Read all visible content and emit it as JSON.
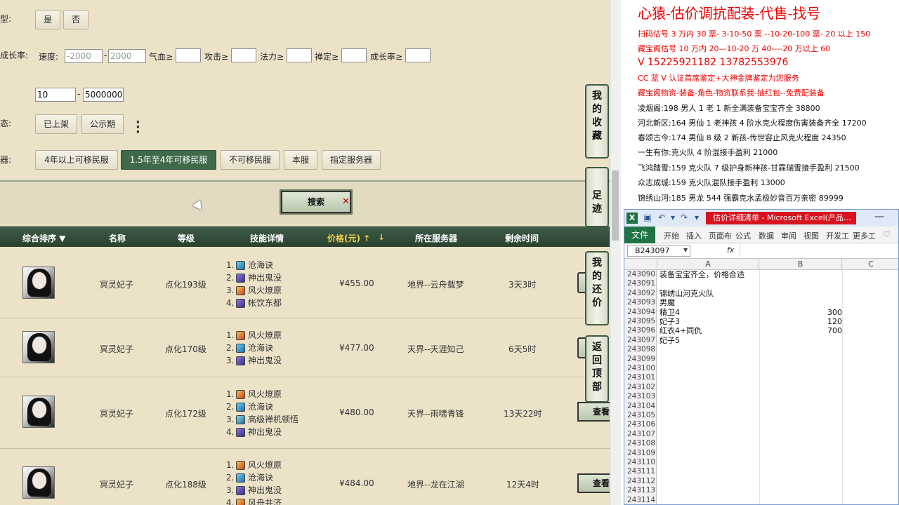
{
  "filters": {
    "type_label": "类型:",
    "yes_label": "是",
    "no_label": "否",
    "attr_label": "加成长率:",
    "speed_label": "速度:",
    "speed_min_placeholder": "-2000",
    "speed_max_placeholder": "2000",
    "hp_label": "气血≥",
    "atk_label": "攻击≥",
    "magic_label": "法力≥",
    "zen_label": "禅定≥",
    "growth_label": "成长率≥",
    "range_min": "10",
    "range_max": "5000000",
    "status_label": "状态:",
    "on_shelf_label": "已上架",
    "public_label": "公示期",
    "server_label": "服务器:",
    "migrate_options": [
      "4年以上可移民服",
      "1.5年至4年可移民服",
      "不可移民服",
      "本服",
      "指定服务器"
    ],
    "dash": "-"
  },
  "search_label": "搜索",
  "table": {
    "headers": [
      "综合排序 ▼",
      "名称",
      "等级",
      "技能详情",
      "价格(元) ↑",
      "所在服务器",
      "剩余时间"
    ],
    "price_arrow": "↓",
    "rows": [
      {
        "name": "冥灵妃子",
        "level": "点化193级",
        "price": "¥455.00",
        "server": "地界--云舟载梦",
        "time": "3天3时",
        "skills": [
          {
            "n": "1.",
            "t": "沧海诀",
            "i": "water"
          },
          {
            "n": "2.",
            "t": "神出鬼没",
            "i": "ghost"
          },
          {
            "n": "3.",
            "t": "风火燎原",
            "i": "fire"
          },
          {
            "n": "4.",
            "t": "帐饮东都",
            "i": "ghost"
          }
        ]
      },
      {
        "name": "冥灵妃子",
        "level": "点化170级",
        "price": "¥477.00",
        "server": "天界--天涯知己",
        "time": "6天5时",
        "skills": [
          {
            "n": "1.",
            "t": "风火燎原",
            "i": "fire"
          },
          {
            "n": "2.",
            "t": "沧海诀",
            "i": "water"
          },
          {
            "n": "3.",
            "t": "神出鬼没",
            "i": "ghost"
          }
        ]
      },
      {
        "name": "冥灵妃子",
        "level": "点化172级",
        "price": "¥480.00",
        "server": "天界--雨啸青锋",
        "time": "13天22时",
        "skills": [
          {
            "n": "1.",
            "t": "风火燎原",
            "i": "fire"
          },
          {
            "n": "2.",
            "t": "沧海诀",
            "i": "water"
          },
          {
            "n": "3.",
            "t": "高级禅机顿悟",
            "i": "zen"
          },
          {
            "n": "4.",
            "t": "神出鬼没",
            "i": "ghost"
          }
        ]
      },
      {
        "name": "冥灵妃子",
        "level": "点化188级",
        "price": "¥484.00",
        "server": "地界--龙在江湖",
        "time": "12天4时",
        "skills": [
          {
            "n": "1.",
            "t": "风火燎原",
            "i": "fire"
          },
          {
            "n": "2.",
            "t": "沧海诀",
            "i": "water"
          },
          {
            "n": "3.",
            "t": "神出鬼没",
            "i": "ghost"
          },
          {
            "n": "4.",
            "t": "风舟共济",
            "i": "fire"
          }
        ]
      }
    ],
    "view_label": "查看"
  },
  "side_tabs": [
    "我的收藏",
    "足迹",
    "我的还价",
    "返回顶部"
  ],
  "ad": {
    "title": "心猿-估价调抗配装-代售-找号",
    "red_lines": [
      "扫码估号 3 万内 30 票- 3-10-50 票 --10-20-100 票- 20 以上 150",
      "藏宝阁估号 10 万内 20—10-20 万 40----20 万以上 60",
      "V 15225921182   13782553976",
      "CC 蓝 V 认证首席鉴定+大神金牌鉴定为您服务",
      "藏宝阁物资-装备-角色-物资联系我-抽红包--免费配装备"
    ],
    "black_lines": [
      {
        "k": "凌烟阁:",
        "v": "198 男人 1 老 1 新全满装备宝宝齐全 38800"
      },
      {
        "k": "河北新区:",
        "v": "164 男仙 1 老神孩 4 阶水克火程度伤害装备齐全 17200"
      },
      {
        "k": "春颂古今:",
        "v": "174 男仙 8 级 2 新孩-传世容止风克火程度 24350"
      },
      {
        "k": "一生有你:",
        "v": "克火队 4 阶混接手盈利 21000"
      },
      {
        "k": "飞鸿踏雪:",
        "v": "159 克火队 7 级护身新神孩-甘霖瑞雪接手盈利 21500"
      },
      {
        "k": "众志成城:",
        "v": "159 克火队混队接手盈利 13000"
      },
      {
        "k": "锦绣山河:",
        "v": "185 男龙 544 强霸克水孟极妙音百万亲密 89999"
      }
    ]
  },
  "excel": {
    "title": "估价详细清单 - Microsoft Excel(产品...",
    "tabs": [
      "文件",
      "开始",
      "插入",
      "页面布",
      "公式",
      "数据",
      "审阅",
      "视图",
      "开发工",
      "更多工"
    ],
    "name_box": "B243097",
    "fx": "fx",
    "cols": [
      "A",
      "B",
      "C"
    ],
    "rows": [
      {
        "r": "243090",
        "a": "装备宝宝齐全，价格合适",
        "b": ""
      },
      {
        "r": "243091",
        "a": "",
        "b": ""
      },
      {
        "r": "243092",
        "a": "锦绣山河克火队",
        "b": ""
      },
      {
        "r": "243093",
        "a": "男魔",
        "b": ""
      },
      {
        "r": "243094",
        "a": "精卫4",
        "b": "300"
      },
      {
        "r": "243095",
        "a": "妃子3",
        "b": "120"
      },
      {
        "r": "243096",
        "a": "红衣4+同仇",
        "b": "700"
      },
      {
        "r": "243097",
        "a": "妃子5",
        "b": ""
      },
      {
        "r": "243098",
        "a": "",
        "b": ""
      },
      {
        "r": "243099",
        "a": "",
        "b": ""
      },
      {
        "r": "243100",
        "a": "",
        "b": ""
      },
      {
        "r": "243101",
        "a": "",
        "b": ""
      },
      {
        "r": "243102",
        "a": "",
        "b": ""
      },
      {
        "r": "243103",
        "a": "",
        "b": ""
      },
      {
        "r": "243104",
        "a": "",
        "b": ""
      },
      {
        "r": "243105",
        "a": "",
        "b": ""
      },
      {
        "r": "243106",
        "a": "",
        "b": ""
      },
      {
        "r": "243107",
        "a": "",
        "b": ""
      },
      {
        "r": "243108",
        "a": "",
        "b": ""
      },
      {
        "r": "243109",
        "a": "",
        "b": ""
      },
      {
        "r": "243110",
        "a": "",
        "b": ""
      },
      {
        "r": "243111",
        "a": "",
        "b": ""
      },
      {
        "r": "243112",
        "a": "",
        "b": ""
      },
      {
        "r": "243113",
        "a": "",
        "b": ""
      },
      {
        "r": "243114",
        "a": "",
        "b": ""
      }
    ]
  }
}
